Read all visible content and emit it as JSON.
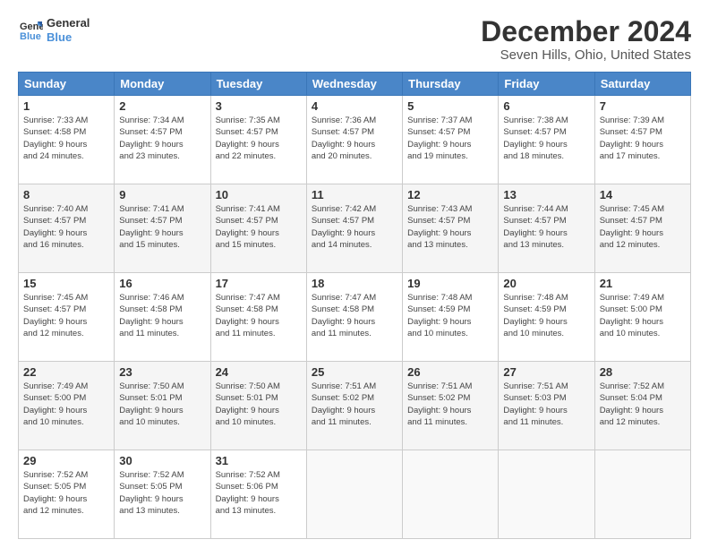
{
  "header": {
    "logo_line1": "General",
    "logo_line2": "Blue",
    "title": "December 2024",
    "subtitle": "Seven Hills, Ohio, United States"
  },
  "columns": [
    "Sunday",
    "Monday",
    "Tuesday",
    "Wednesday",
    "Thursday",
    "Friday",
    "Saturday"
  ],
  "weeks": [
    [
      {
        "day": "1",
        "info": "Sunrise: 7:33 AM\nSunset: 4:58 PM\nDaylight: 9 hours\nand 24 minutes."
      },
      {
        "day": "2",
        "info": "Sunrise: 7:34 AM\nSunset: 4:57 PM\nDaylight: 9 hours\nand 23 minutes."
      },
      {
        "day": "3",
        "info": "Sunrise: 7:35 AM\nSunset: 4:57 PM\nDaylight: 9 hours\nand 22 minutes."
      },
      {
        "day": "4",
        "info": "Sunrise: 7:36 AM\nSunset: 4:57 PM\nDaylight: 9 hours\nand 20 minutes."
      },
      {
        "day": "5",
        "info": "Sunrise: 7:37 AM\nSunset: 4:57 PM\nDaylight: 9 hours\nand 19 minutes."
      },
      {
        "day": "6",
        "info": "Sunrise: 7:38 AM\nSunset: 4:57 PM\nDaylight: 9 hours\nand 18 minutes."
      },
      {
        "day": "7",
        "info": "Sunrise: 7:39 AM\nSunset: 4:57 PM\nDaylight: 9 hours\nand 17 minutes."
      }
    ],
    [
      {
        "day": "8",
        "info": "Sunrise: 7:40 AM\nSunset: 4:57 PM\nDaylight: 9 hours\nand 16 minutes."
      },
      {
        "day": "9",
        "info": "Sunrise: 7:41 AM\nSunset: 4:57 PM\nDaylight: 9 hours\nand 15 minutes."
      },
      {
        "day": "10",
        "info": "Sunrise: 7:41 AM\nSunset: 4:57 PM\nDaylight: 9 hours\nand 15 minutes."
      },
      {
        "day": "11",
        "info": "Sunrise: 7:42 AM\nSunset: 4:57 PM\nDaylight: 9 hours\nand 14 minutes."
      },
      {
        "day": "12",
        "info": "Sunrise: 7:43 AM\nSunset: 4:57 PM\nDaylight: 9 hours\nand 13 minutes."
      },
      {
        "day": "13",
        "info": "Sunrise: 7:44 AM\nSunset: 4:57 PM\nDaylight: 9 hours\nand 13 minutes."
      },
      {
        "day": "14",
        "info": "Sunrise: 7:45 AM\nSunset: 4:57 PM\nDaylight: 9 hours\nand 12 minutes."
      }
    ],
    [
      {
        "day": "15",
        "info": "Sunrise: 7:45 AM\nSunset: 4:57 PM\nDaylight: 9 hours\nand 12 minutes."
      },
      {
        "day": "16",
        "info": "Sunrise: 7:46 AM\nSunset: 4:58 PM\nDaylight: 9 hours\nand 11 minutes."
      },
      {
        "day": "17",
        "info": "Sunrise: 7:47 AM\nSunset: 4:58 PM\nDaylight: 9 hours\nand 11 minutes."
      },
      {
        "day": "18",
        "info": "Sunrise: 7:47 AM\nSunset: 4:58 PM\nDaylight: 9 hours\nand 11 minutes."
      },
      {
        "day": "19",
        "info": "Sunrise: 7:48 AM\nSunset: 4:59 PM\nDaylight: 9 hours\nand 10 minutes."
      },
      {
        "day": "20",
        "info": "Sunrise: 7:48 AM\nSunset: 4:59 PM\nDaylight: 9 hours\nand 10 minutes."
      },
      {
        "day": "21",
        "info": "Sunrise: 7:49 AM\nSunset: 5:00 PM\nDaylight: 9 hours\nand 10 minutes."
      }
    ],
    [
      {
        "day": "22",
        "info": "Sunrise: 7:49 AM\nSunset: 5:00 PM\nDaylight: 9 hours\nand 10 minutes."
      },
      {
        "day": "23",
        "info": "Sunrise: 7:50 AM\nSunset: 5:01 PM\nDaylight: 9 hours\nand 10 minutes."
      },
      {
        "day": "24",
        "info": "Sunrise: 7:50 AM\nSunset: 5:01 PM\nDaylight: 9 hours\nand 10 minutes."
      },
      {
        "day": "25",
        "info": "Sunrise: 7:51 AM\nSunset: 5:02 PM\nDaylight: 9 hours\nand 11 minutes."
      },
      {
        "day": "26",
        "info": "Sunrise: 7:51 AM\nSunset: 5:02 PM\nDaylight: 9 hours\nand 11 minutes."
      },
      {
        "day": "27",
        "info": "Sunrise: 7:51 AM\nSunset: 5:03 PM\nDaylight: 9 hours\nand 11 minutes."
      },
      {
        "day": "28",
        "info": "Sunrise: 7:52 AM\nSunset: 5:04 PM\nDaylight: 9 hours\nand 12 minutes."
      }
    ],
    [
      {
        "day": "29",
        "info": "Sunrise: 7:52 AM\nSunset: 5:05 PM\nDaylight: 9 hours\nand 12 minutes."
      },
      {
        "day": "30",
        "info": "Sunrise: 7:52 AM\nSunset: 5:05 PM\nDaylight: 9 hours\nand 13 minutes."
      },
      {
        "day": "31",
        "info": "Sunrise: 7:52 AM\nSunset: 5:06 PM\nDaylight: 9 hours\nand 13 minutes."
      },
      {
        "day": "",
        "info": ""
      },
      {
        "day": "",
        "info": ""
      },
      {
        "day": "",
        "info": ""
      },
      {
        "day": "",
        "info": ""
      }
    ]
  ]
}
